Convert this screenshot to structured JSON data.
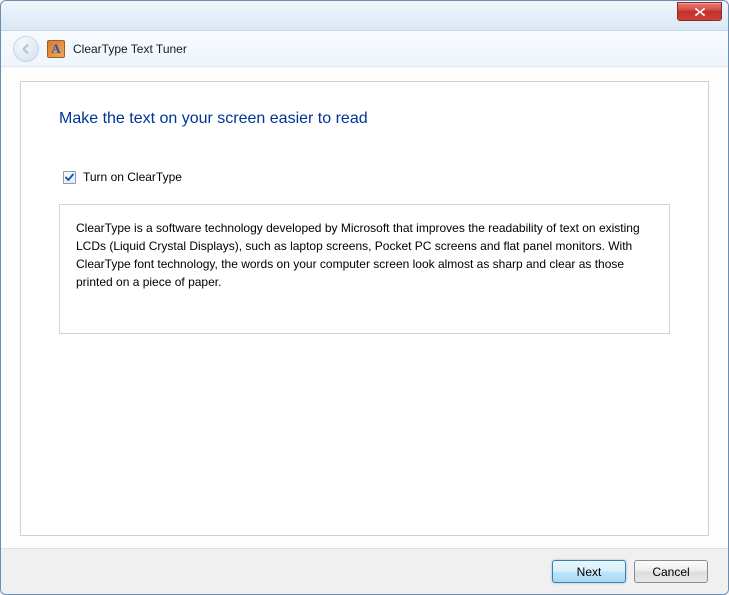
{
  "window": {
    "title": "ClearType Text Tuner"
  },
  "main": {
    "heading": "Make the text on your screen easier to read",
    "checkbox_label": "Turn on ClearType",
    "checkbox_checked": true,
    "info_text": "ClearType is a software technology developed by Microsoft that improves the readability of text on existing LCDs (Liquid Crystal Displays), such as laptop screens, Pocket PC screens and flat panel monitors. With ClearType font technology, the words on your computer screen look almost as sharp and clear as those printed on a piece of paper."
  },
  "footer": {
    "next_label": "Next",
    "cancel_label": "Cancel"
  },
  "icons": {
    "app_letter": "A"
  }
}
